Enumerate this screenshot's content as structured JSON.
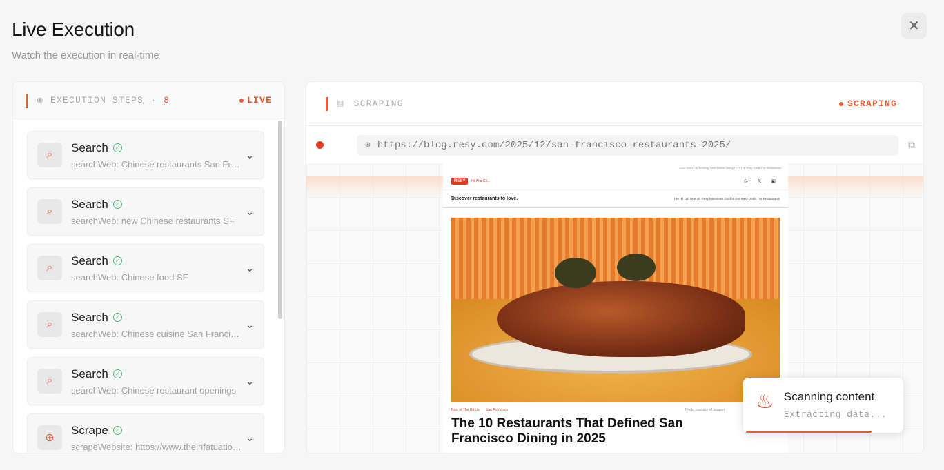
{
  "header": {
    "title": "Live Execution",
    "subtitle": "Watch the execution in real-time",
    "close_icon": "✕"
  },
  "steps_panel": {
    "label": "EXECUTION STEPS",
    "separator": "·",
    "count": "8",
    "live_label": "LIVE",
    "items": [
      {
        "icon": "search-icon",
        "name": "Search",
        "desc": "searchWeb: Chinese restaurants San Francisco"
      },
      {
        "icon": "search-icon",
        "name": "Search",
        "desc": "searchWeb: new Chinese restaurants SF"
      },
      {
        "icon": "search-icon",
        "name": "Search",
        "desc": "searchWeb: Chinese food SF"
      },
      {
        "icon": "search-icon",
        "name": "Search",
        "desc": "searchWeb: Chinese cuisine San Francisco"
      },
      {
        "icon": "search-icon",
        "name": "Search",
        "desc": "searchWeb: Chinese restaurant openings"
      },
      {
        "icon": "globe-icon",
        "name": "Scrape",
        "desc": "scrapeWebsite: https://www.theinfatuation.com"
      }
    ]
  },
  "browser_panel": {
    "label": "SCRAPING",
    "status": "SCRAPING",
    "url": "https://blog.resy.com/2025/12/san-francisco-restaurants-2025/"
  },
  "page_preview": {
    "logo": "RESY",
    "logo_sub": "Hit Ana Gil...",
    "top_links": "2025 Sushi Lilo Brewing Shim   Mobile Dining Hi-Fi   The Resy Guide   For Restaurants",
    "social_icons": "◎ 𝕏 ▣",
    "tagline": "Discover restaurants to love.",
    "nav_links": "The Hit List    New on Resy    Interviews    Guides    Get Resy Deals    For Restaurants",
    "tag_1": "Best of The Hit List",
    "tag_2": "San Francisco",
    "credit": "Photo courtesy of Imagen",
    "headline": "The 10 Restaurants That Defined San Francisco Dining in 2025"
  },
  "toast": {
    "title": "Scanning content",
    "subtitle": "Extracting data..."
  },
  "colors": {
    "accent": "#ea5a33",
    "success": "#4bbd7a",
    "record": "#e33b22"
  }
}
